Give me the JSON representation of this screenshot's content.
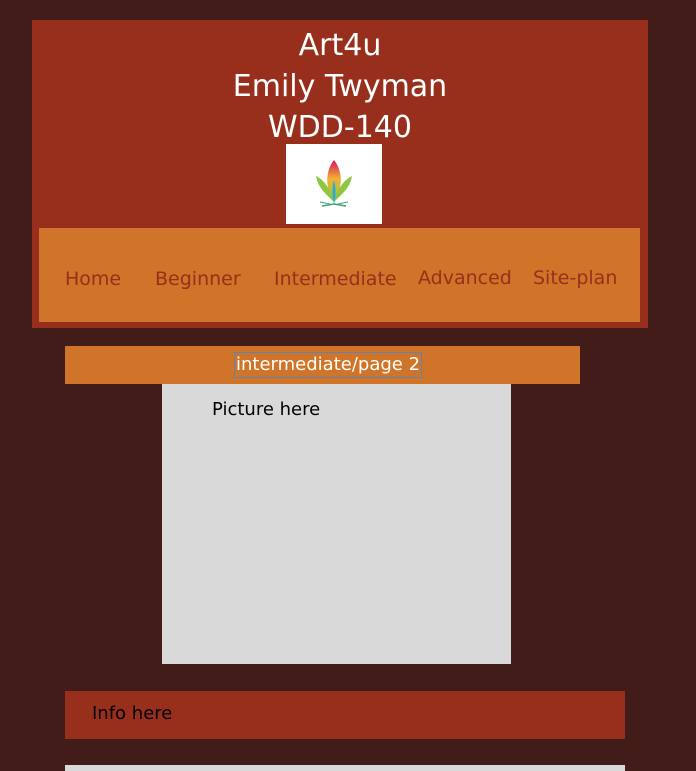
{
  "header": {
    "title_lines": [
      "Art4u",
      "Emily Twyman",
      "WDD-140"
    ],
    "logo": {
      "icon": "lotus-icon",
      "colors": [
        "#d8125b",
        "#f2b233",
        "#8dc63f",
        "#27a9e1"
      ]
    }
  },
  "nav": {
    "items": [
      {
        "label": "Home"
      },
      {
        "label": "Beginner"
      },
      {
        "label": "Intermediate"
      },
      {
        "label": "Advanced"
      },
      {
        "label": "Site-plan"
      }
    ]
  },
  "breadcrumb": {
    "text": "intermediate/page 2"
  },
  "picture": {
    "label": "Picture here"
  },
  "info": {
    "label": "Info here"
  },
  "colors": {
    "background": "#421c19",
    "header": "#982f1c",
    "nav": "#cf7428",
    "nav_text": "#982f1c",
    "placeholder": "#d9d9d9"
  }
}
